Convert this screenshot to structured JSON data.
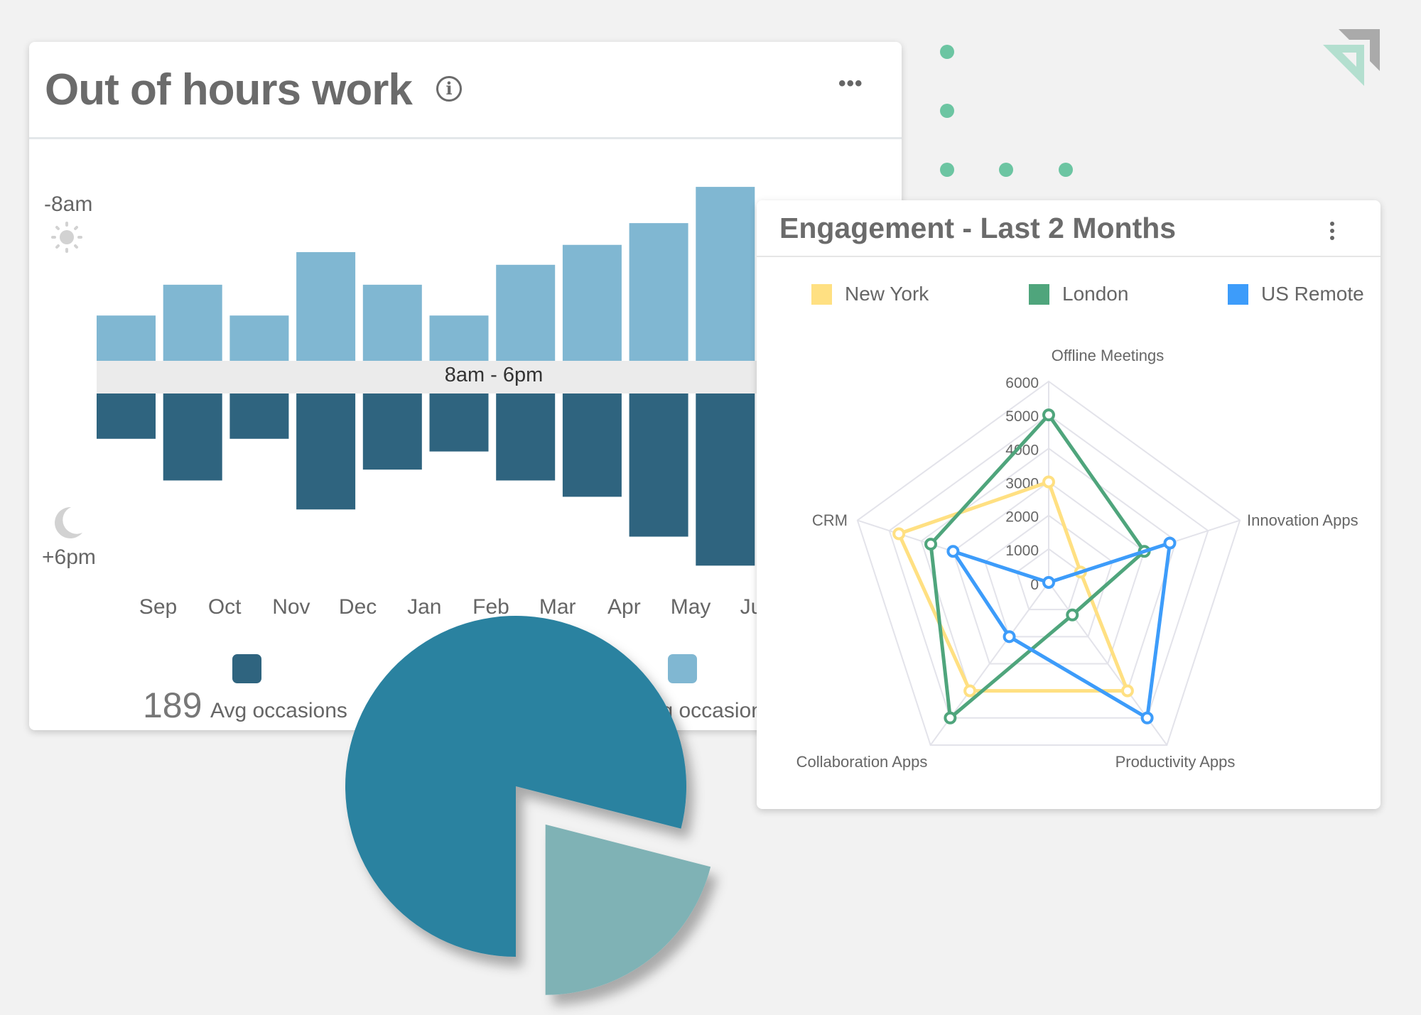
{
  "decor": {
    "dot_color": "#6cc5a2",
    "logo_colors": [
      "#b3dfcf",
      "#aaaaaa"
    ]
  },
  "out_of_hours": {
    "title": "Out of hours work",
    "info_icon": "info-icon",
    "more_label": "•••",
    "top_label": "-8am",
    "bottom_label": "+6pm",
    "band_label": "8am - 6pm",
    "legend": [
      {
        "color": "#2f647f",
        "value": "189",
        "label": "Avg occasions"
      },
      {
        "color": "#80b7d2",
        "label": "Avg occasions"
      }
    ]
  },
  "engagement": {
    "title": "Engagement - Last 2 Months",
    "legend": [
      "New York",
      "London",
      "US Remote"
    ]
  },
  "chart_data": [
    {
      "type": "bar",
      "title": "Out of hours work",
      "categories": [
        "Sep",
        "Oct",
        "Nov",
        "Dec",
        "Jan",
        "Feb",
        "Mar",
        "Apr",
        "May",
        "Jun"
      ],
      "series": [
        {
          "name": "-8am",
          "color": "#80b7d2",
          "values": [
            25,
            42,
            25,
            60,
            42,
            25,
            53,
            64,
            76,
            96
          ]
        },
        {
          "name": "+6pm",
          "color": "#2f647f",
          "values": [
            25,
            48,
            25,
            64,
            42,
            32,
            48,
            57,
            79,
            95
          ]
        }
      ],
      "band_label": "8am - 6pm",
      "grid": false
    },
    {
      "type": "radar",
      "title": "Engagement - Last 2 Months",
      "axes": [
        "Offline Meetings",
        "Innovation Apps",
        "Productivity Apps",
        "Collaboration Apps",
        "CRM"
      ],
      "ticks": [
        "0",
        "1000",
        "2000",
        "3000",
        "4000",
        "5000",
        "6000"
      ],
      "range": [
        0,
        6000
      ],
      "legend_position": "top",
      "series": [
        {
          "name": "New York",
          "color": "#ffe082",
          "values": [
            3000,
            1000,
            4000,
            4000,
            4700
          ]
        },
        {
          "name": "London",
          "color": "#4fa57c",
          "values": [
            5000,
            3000,
            1200,
            5000,
            3700
          ]
        },
        {
          "name": "US Remote",
          "color": "#3d9cfa",
          "values": [
            0,
            3800,
            5000,
            2000,
            3000
          ]
        }
      ]
    },
    {
      "type": "pie",
      "values": [
        79,
        21
      ],
      "colors": [
        "#2a82a0",
        "#7fb2b5"
      ],
      "exploded": [
        false,
        true
      ]
    }
  ]
}
